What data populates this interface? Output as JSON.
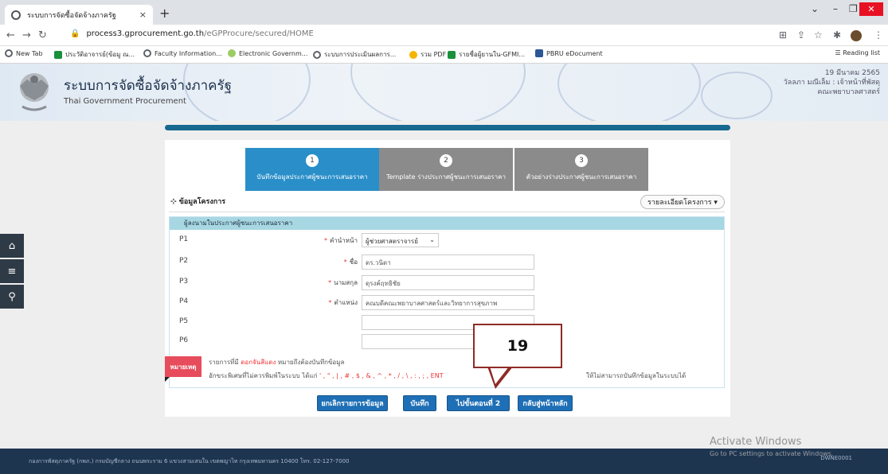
{
  "browser": {
    "tab_title": "ระบบการจัดซื้อจัดจ้างภาครัฐ",
    "tab_close": "×",
    "new_tab": "+",
    "url_host": "process3.gprocurement.go.th",
    "url_path": "/eGPProcure/secured/HOME",
    "bookmarks": [
      {
        "label": "New Tab",
        "color": "#5f6368"
      },
      {
        "label": "ประวัติอาจารย์(ข้อมู ณ...",
        "color": "#1a8f3c"
      },
      {
        "label": "Faculty Information...",
        "color": "#5f6368"
      },
      {
        "label": "Electronic Governm...",
        "color": "#9ccc65"
      },
      {
        "label": "ระบบการประเมินผลการ...",
        "color": "#5f6368"
      },
      {
        "label": "รวม PDF",
        "color": "#f4b400"
      },
      {
        "label": "รายชื่อผู้ยานใน-GFMI...",
        "color": "#1a8f3c"
      },
      {
        "label": "PBRU eDocument",
        "color": "#2b5797"
      }
    ],
    "reading_list": "Reading list"
  },
  "site": {
    "title": "ระบบการจัดซื้อจัดจ้างภาครัฐ",
    "subtitle": "Thai Government Procurement",
    "date": "19 มีนาคม 2565",
    "user_line1": "วัลลภา มณีเล็ม : เจ้าหน้าที่พัสดุ",
    "user_line2": "คณะพยาบาลศาสตร์"
  },
  "steps": [
    {
      "num": "1",
      "label": "บันทึกข้อมูลประกาศผู้ชนะการเสนอราคา"
    },
    {
      "num": "2",
      "label": "Template ร่างประกาศผู้ชนะการเสนอราคา"
    },
    {
      "num": "3",
      "label": "ตัวอย่างร่างประกาศผู้ชนะการเสนอราคา"
    }
  ],
  "project": {
    "section_title": "ข้อมูลโครงการ",
    "detail_button": "รายละเอียดโครงการ ▾"
  },
  "form": {
    "header": "ผู้ลงนามในประกาศผู้ชนะการเสนอราคา",
    "rows": [
      {
        "p": "P1",
        "label": "คำนำหน้า",
        "value": "ผู้ช่วยศาสตราจารย์"
      },
      {
        "p": "P2",
        "label": "ชื่อ",
        "value": "ดร.วนิดา"
      },
      {
        "p": "P3",
        "label": "นามสกุล",
        "value": "ดุรงค์ฤทธิชัย"
      },
      {
        "p": "P4",
        "label": "ตำแหน่ง",
        "value": "คณบดีคณะพยาบาลศาสตร์และวิทยาการสุขภาพ"
      },
      {
        "p": "P5",
        "label": "",
        "value": ""
      },
      {
        "p": "P6",
        "label": "",
        "value": ""
      }
    ]
  },
  "note": {
    "tag": "หมายเหตุ",
    "line1_prefix": "รายการที่มี",
    "line1_red": "ดอกจันสีแดง",
    "line1_suffix": "หมายถึงต้องบันทึกข้อมูล",
    "line2_prefix": "อักขระพิเศษที่ไม่ควรพิมพ์ในระบบ ได้แก่",
    "line2_red": "' , \" , | , # , $ , & , ^ , * , / , \\ , : , ; , ENT",
    "line3": "ให้ไม่สามารถบันทึกข้อมูลในระบบได้"
  },
  "buttons": {
    "cancel": "ยกเลิกรายการข้อมูล",
    "save": "บันทึก",
    "next": "ไปขั้นตอนที่ 2",
    "back": "กลับสู่หน้าหลัก"
  },
  "callout": "19",
  "watermark": {
    "line1": "Activate Windows",
    "line2": "Go to PC settings to activate Windows."
  },
  "footer": {
    "text": "กองการพัสดุภาครัฐ (กพภ.) กรมบัญชีกลาง ถนนพระราม 6 แขวงสามเสนใน เขตพญาไท กรุงเทพมหานคร 10400 โทร. 02-127-7000",
    "code": "DWNE0001"
  }
}
